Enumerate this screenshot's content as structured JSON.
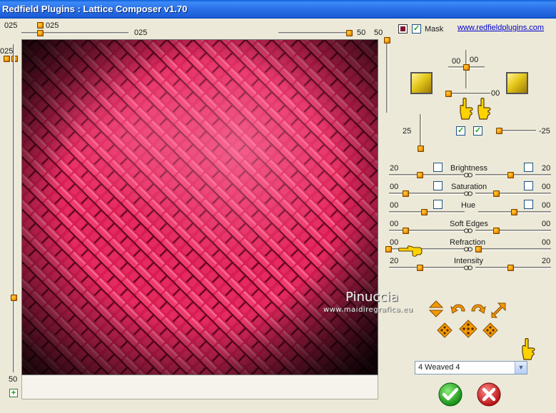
{
  "window": {
    "title": "Redfield Plugins : Lattice Composer v1.70"
  },
  "top": {
    "left_value": "025",
    "h_slider_value": "025",
    "h_slider_end": "025",
    "right_slider_value": "50",
    "right_value": "50"
  },
  "left_slider": {
    "top_value": "025",
    "bottom_value": "50"
  },
  "header": {
    "mask_label": "Mask",
    "mask_checked": true,
    "link": "www.redfieldplugins.com"
  },
  "light": {
    "val1": "00",
    "val2": "00",
    "val3": "00"
  },
  "angle": {
    "left": "25",
    "right": "-25"
  },
  "params": [
    {
      "label": "Brightness",
      "left": "20",
      "right": "20"
    },
    {
      "label": "Saturation",
      "left": "00",
      "right": "00"
    },
    {
      "label": "Hue",
      "left": "00",
      "right": "00"
    },
    {
      "label": "Soft Edges",
      "left": "00",
      "right": "00"
    },
    {
      "label": "Refraction",
      "left": "00",
      "right": "00"
    },
    {
      "label": "Intensity",
      "left": "20",
      "right": "20"
    }
  ],
  "watermark": {
    "name": "Pinuccia",
    "url": "www.maidiregrafica.eu"
  },
  "preset": {
    "selected": "4 Weaved 4"
  },
  "colors": {
    "accent": "#f29a00",
    "preview": "#c8164a",
    "ok": "#1fa31f",
    "cancel": "#d42020"
  }
}
